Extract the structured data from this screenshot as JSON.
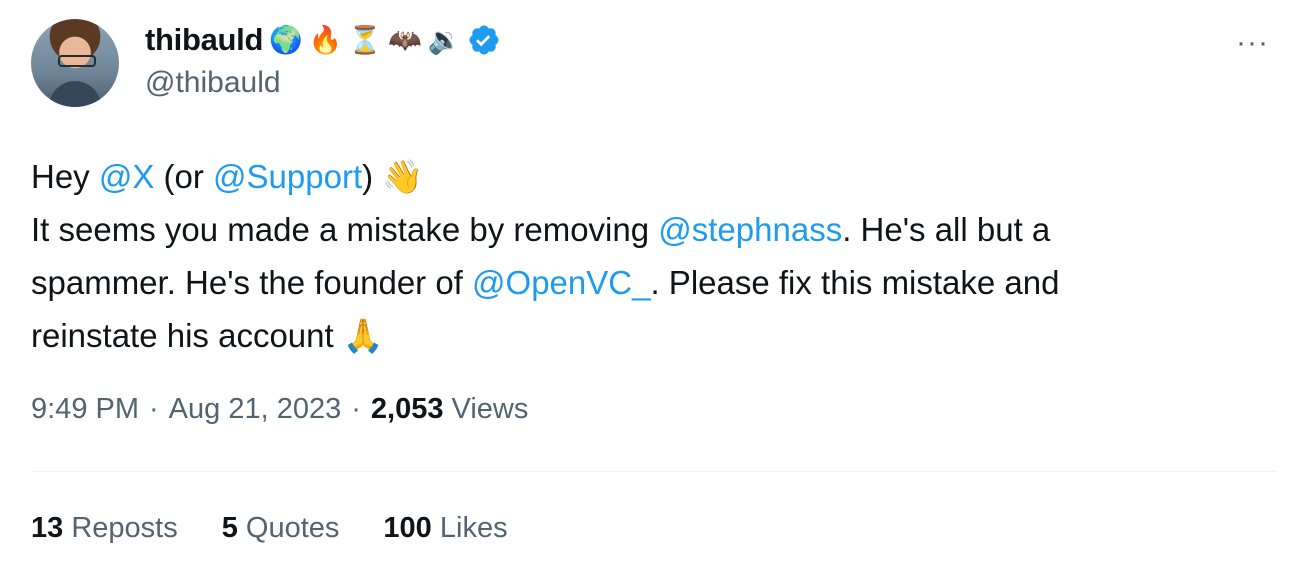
{
  "author": {
    "display_name": "thibauld",
    "handle": "@thibauld",
    "name_emojis": [
      "🌍",
      "🔥",
      "⏳",
      "🦇",
      "🔉"
    ],
    "verified_color": "#1d9bf0"
  },
  "menu": {
    "more_label": "···"
  },
  "tweet": {
    "line1": {
      "t1": "Hey ",
      "m1": "@X",
      "t2": " (or ",
      "m2": "@Support",
      "t3": ") ",
      "emoji": "👋"
    },
    "line2": {
      "t1": "It seems you made a mistake by removing ",
      "m1": "@stephnass",
      "t2": ". He's all but a"
    },
    "line3": {
      "t1": "spammer. He's the founder of ",
      "m1": "@OpenVC_",
      "t2": ". Please fix this mistake and"
    },
    "line4": {
      "t1": "reinstate his account ",
      "emoji": "🙏"
    }
  },
  "meta": {
    "time": "9:49 PM",
    "sep1": "·",
    "date": "Aug 21, 2023",
    "sep2": "·",
    "views_count": "2,053",
    "views_label": "Views"
  },
  "stats": {
    "reposts_count": "13",
    "reposts_label": "Reposts",
    "quotes_count": "5",
    "quotes_label": "Quotes",
    "likes_count": "100",
    "likes_label": "Likes"
  },
  "colors": {
    "link": "#1d9bf0",
    "text": "#0f1419",
    "muted": "#536471"
  }
}
